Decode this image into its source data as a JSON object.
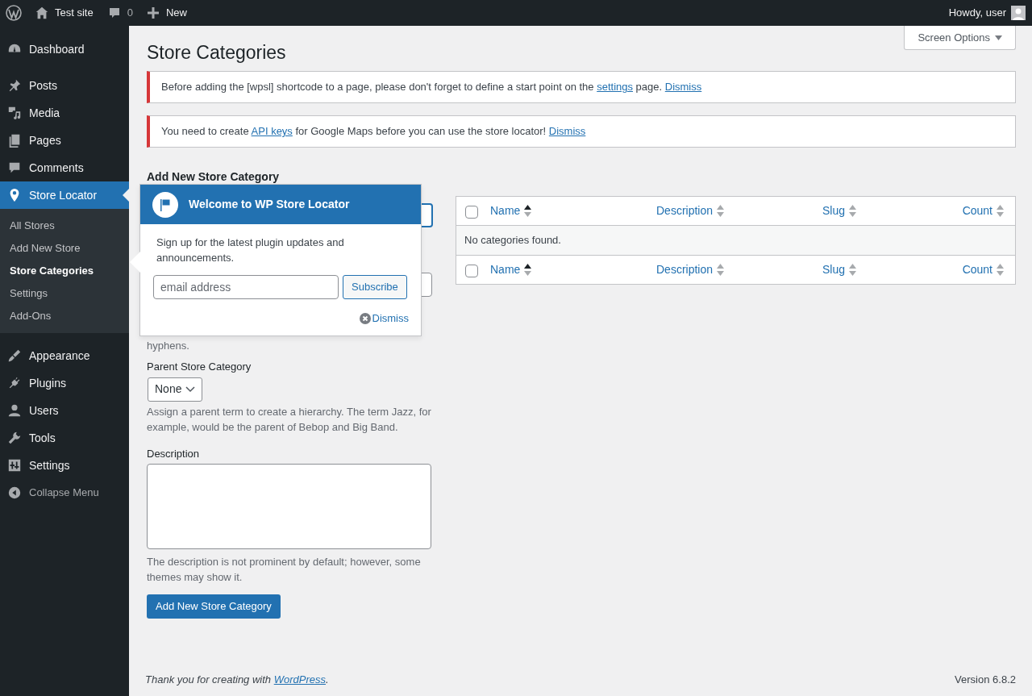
{
  "admin_bar": {
    "site": "Test site",
    "comments": "0",
    "new": "New",
    "greeting": "Howdy, user"
  },
  "sidebar": {
    "items": [
      {
        "label": "Dashboard",
        "selected": false
      },
      {
        "label": "Posts",
        "selected": false
      },
      {
        "label": "Media",
        "selected": false
      },
      {
        "label": "Pages",
        "selected": false
      },
      {
        "label": "Comments",
        "selected": false
      },
      {
        "label": "Store Locator",
        "selected": true,
        "children": [
          {
            "label": "All Stores",
            "selected": false
          },
          {
            "label": "Add New Store",
            "selected": false
          },
          {
            "label": "Store Categories",
            "selected": true
          },
          {
            "label": "Settings",
            "selected": false
          },
          {
            "label": "Add-Ons",
            "selected": false
          }
        ]
      },
      {
        "label": "Appearance",
        "selected": false
      },
      {
        "label": "Plugins",
        "selected": false
      },
      {
        "label": "Users",
        "selected": false
      },
      {
        "label": "Tools",
        "selected": false
      },
      {
        "label": "Settings",
        "selected": false
      },
      {
        "label": "Collapse Menu",
        "selected": false
      }
    ]
  },
  "screen_options": "Screen Options",
  "title": "Store Categories",
  "notices": [
    {
      "parts": [
        {
          "text": "Before adding the [wpsl] shortcode to a page, please don't forget to define a start point on the "
        },
        {
          "link": "settings"
        },
        {
          "text": " page. "
        },
        {
          "link": "Dismiss"
        }
      ]
    },
    {
      "parts": [
        {
          "text": "You need to create "
        },
        {
          "link": "API keys"
        },
        {
          "text": " for Google Maps before you can use the store locator! "
        },
        {
          "link": "Dismiss"
        }
      ]
    }
  ],
  "form": {
    "heading": "Add New Store Category",
    "slug_help_end": "hyphens.",
    "parent_label": "Parent Store Category",
    "parent_value": "None",
    "parent_help": "Assign a parent term to create a hierarchy. The term Jazz, for example, would be the parent of Bebop and Big Band.",
    "description_label": "Description",
    "description_help": "The description is not prominent by default; however, some themes may show it.",
    "submit": "Add New Store Category"
  },
  "table": {
    "header_checkbox": {
      "checked": false
    },
    "columns": [
      {
        "label": "Name",
        "sorted": true
      },
      {
        "label": "Description",
        "sorted": false
      },
      {
        "label": "Slug",
        "sorted": false
      },
      {
        "label": "Count",
        "sorted": false
      }
    ],
    "empty_text": "No categories found.",
    "footer_checkbox": {
      "checked": false
    },
    "footer_columns": [
      {
        "label": "Name",
        "sorted": true
      },
      {
        "label": "Description",
        "sorted": false
      },
      {
        "label": "Slug",
        "sorted": false
      },
      {
        "label": "Count",
        "sorted": false
      }
    ]
  },
  "popup": {
    "title": "Welcome to WP Store Locator",
    "text": "Sign up for the latest plugin updates and announcements.",
    "email_placeholder": "email address",
    "subscribe": "Subscribe",
    "dismiss": "Dismiss"
  },
  "footer": {
    "thanks": "Thank you for creating with ",
    "link": "WordPress",
    "end": ".",
    "version": "Version 6.8.2"
  }
}
